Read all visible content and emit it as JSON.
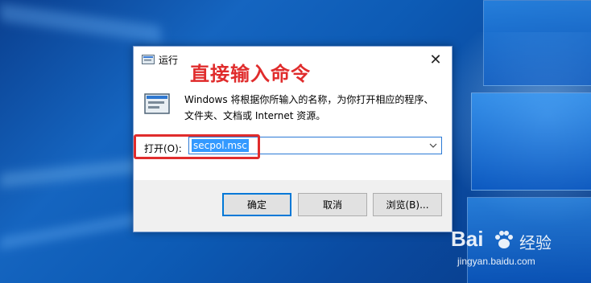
{
  "dialog": {
    "title": "运行",
    "close_label": "✕",
    "description_line1": "Windows 将根据你所输入的名称，为你打开相应的程序、",
    "description_line2": "文件夹、文档或 Internet 资源。",
    "open_label": "打开(O):",
    "open_value": "secpol.msc",
    "ok_label": "确定",
    "cancel_label": "取消",
    "browse_label": "浏览(B)..."
  },
  "annotation": {
    "text": "直接输入命令",
    "color": "#e02c2c"
  },
  "watermark": {
    "logo": "Bai",
    "logo_suffix": "经验",
    "url": "jingyan.baidu.com"
  },
  "colors": {
    "accent": "#0078d7",
    "selection": "#3399ff",
    "highlight": "#e02c2c"
  }
}
